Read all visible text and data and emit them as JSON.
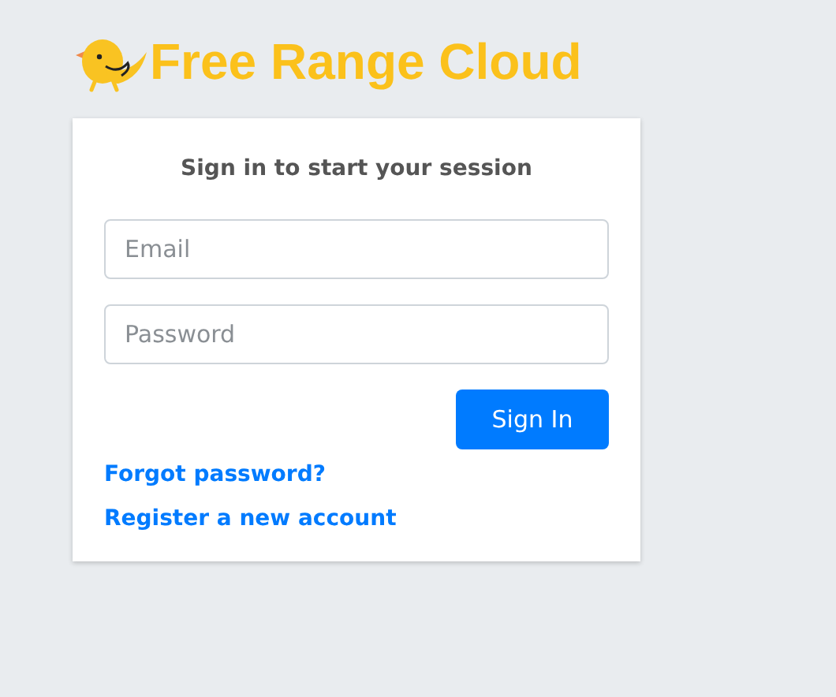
{
  "brand": {
    "name": "Free Range Cloud"
  },
  "login_box": {
    "title": "Sign in to start your session",
    "fields": [
      {
        "placeholder": "Email"
      },
      {
        "placeholder": "Password"
      }
    ],
    "submit_button": "Sign In",
    "links": [
      "Forgot password?",
      "Register a new account"
    ]
  }
}
